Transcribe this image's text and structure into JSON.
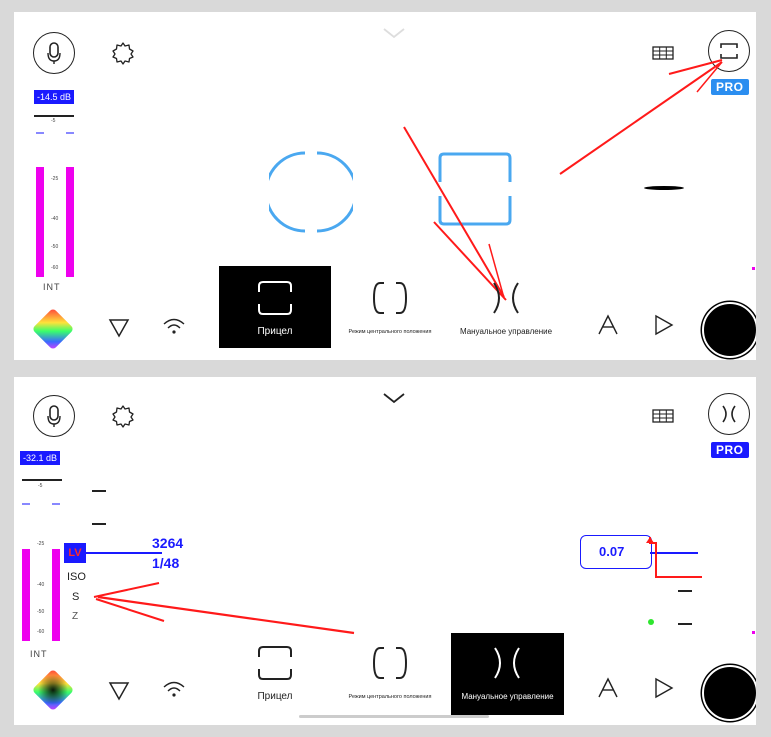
{
  "top": {
    "db_meter": "-14.5 dB",
    "scale_ticks": [
      "-5",
      "-25",
      "-40",
      "-50",
      "-60"
    ],
    "int_label": "INT",
    "pro_badge": "PRO",
    "modes": [
      {
        "label": "Прицел",
        "selected": true
      },
      {
        "label": "Режим центрального положения",
        "selected": false
      },
      {
        "label": "Мануальное управление",
        "selected": false
      }
    ]
  },
  "bottom": {
    "db_meter": "-32.1 dB",
    "scale_ticks": [
      "-5",
      "-25",
      "-40",
      "-50",
      "-60"
    ],
    "int_label": "INT",
    "pro_badge": "PRO",
    "param_tabs": [
      "LV",
      "ISO",
      "S",
      "Z"
    ],
    "iso_value": "3264",
    "shutter_value": "1/48",
    "focus_value": "0.07",
    "modes": [
      {
        "label": "Прицел",
        "selected": false
      },
      {
        "label": "Режим центрального положения",
        "selected": false
      },
      {
        "label": "Мануальное управление",
        "selected": true
      }
    ]
  },
  "colors": {
    "accent_blue": "#1a1aff",
    "pro_top_blue": "#2b8ef0",
    "meter_magenta": "#ee00ee",
    "annotation_red": "#ff1a1a",
    "shape_blue": "#4aa8f0"
  },
  "icons": [
    "microphone-icon",
    "settings-gear-icon",
    "chevron-down-icon",
    "grid-icon",
    "frame-mode-icon",
    "color-wheel-icon",
    "triangle-down-icon",
    "wifi-icon",
    "autofocus-a-icon",
    "play-icon"
  ]
}
